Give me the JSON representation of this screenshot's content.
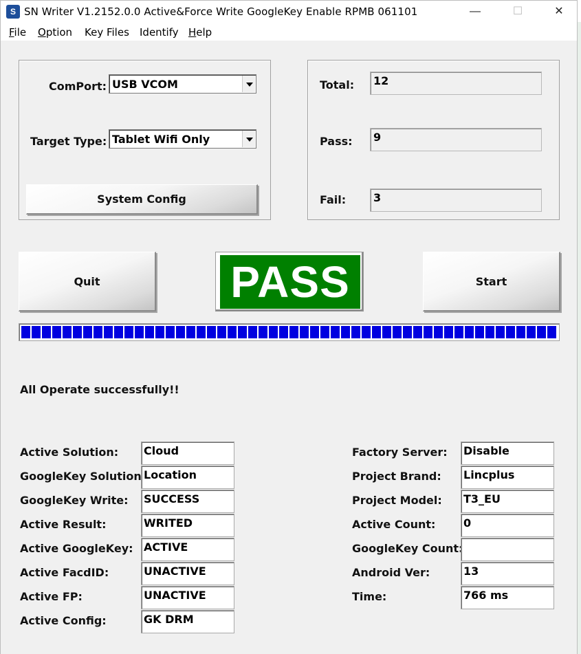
{
  "window": {
    "title": "SN Writer  V1.2152.0.0 Active&Force Write GoogleKey Enable RPMB 061101",
    "controls": {
      "minimize": "—",
      "maximize": "☐",
      "close": "✕"
    },
    "icon": "sn-writer-app-icon"
  },
  "menu": {
    "items": [
      {
        "label": "File",
        "underline": "F",
        "rest": "ile"
      },
      {
        "label": "Option",
        "underline": "O",
        "rest": "ption"
      },
      {
        "label": "Key Files"
      },
      {
        "label": "Identify"
      },
      {
        "label": "Help",
        "underline": "H",
        "rest": "elp"
      }
    ]
  },
  "config": {
    "comport_label": "ComPort:",
    "comport_value": "USB VCOM",
    "target_label": "Target Type:",
    "target_value": "Tablet Wifi Only",
    "system_config_label": "System Config"
  },
  "stats": {
    "total_label": "Total:",
    "total_value": "12",
    "pass_label": "Pass:",
    "pass_value": "9",
    "fail_label": "Fail:",
    "fail_value": "3"
  },
  "actions": {
    "quit_label": "Quit",
    "start_label": "Start",
    "result_text": "PASS",
    "result_color": "#008000"
  },
  "progress": {
    "fraction": 1.0,
    "color": "#0000e0"
  },
  "status": {
    "message": "All Operate successfully!!"
  },
  "details_left": [
    {
      "label": "Active Solution:",
      "value": "Cloud"
    },
    {
      "label": "GoogleKey Solution:",
      "value": "Location"
    },
    {
      "label": "GoogleKey Write:",
      "value": "SUCCESS"
    },
    {
      "label": "Active Result:",
      "value": "WRITED"
    },
    {
      "label": "Active GoogleKey:",
      "value": "ACTIVE"
    },
    {
      "label": "Active FacdID:",
      "value": "UNACTIVE"
    },
    {
      "label": "Active FP:",
      "value": "UNACTIVE"
    },
    {
      "label": "Active Config:",
      "value": "GK DRM"
    }
  ],
  "details_right": [
    {
      "label": "Factory Server:",
      "value": "Disable"
    },
    {
      "label": "Project Brand:",
      "value": "Lincplus"
    },
    {
      "label": "Project Model:",
      "value": "T3_EU"
    },
    {
      "label": "Active Count:",
      "value": "0"
    },
    {
      "label": "GoogleKey Count:",
      "value": ""
    },
    {
      "label": "Android Ver:",
      "value": "13"
    },
    {
      "label": "Time:",
      "value": "766 ms"
    }
  ]
}
